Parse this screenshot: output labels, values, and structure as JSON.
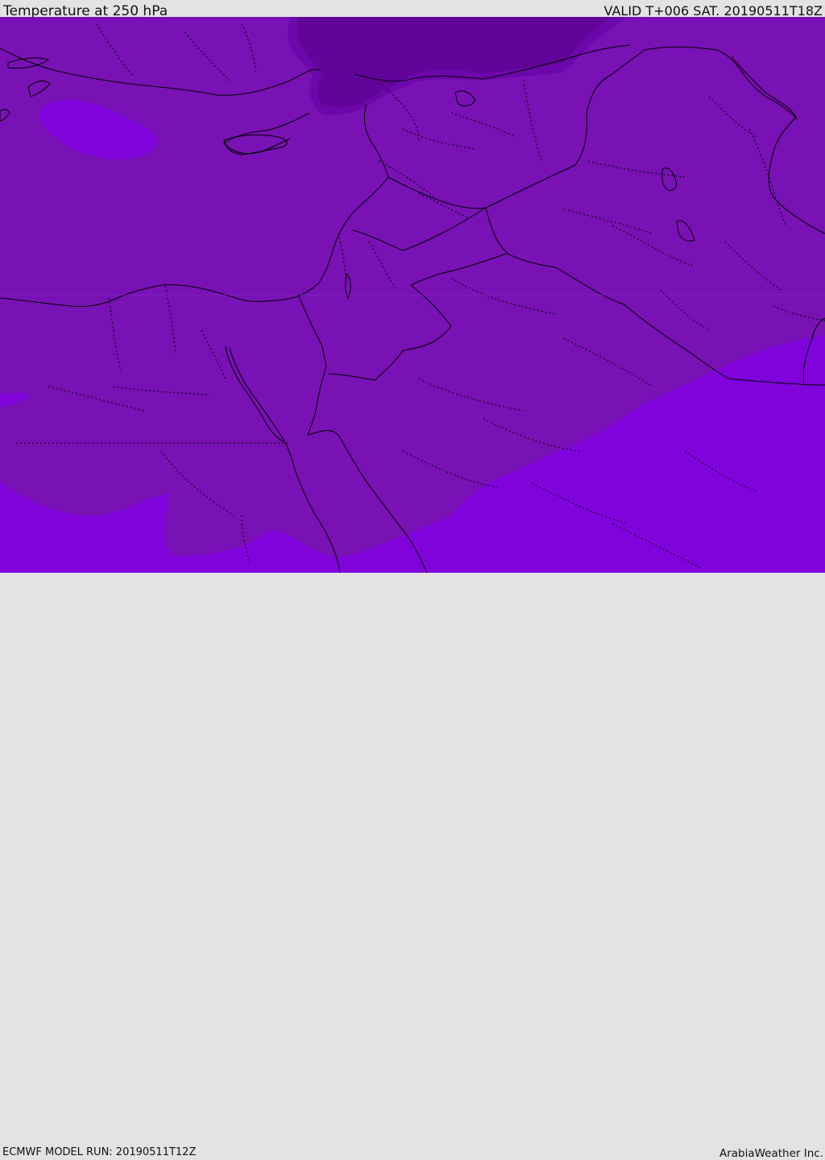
{
  "header": {
    "title": "Temperature at 250 hPa",
    "valid": "VALID T+006 SAT. 20190511T18Z"
  },
  "footer": {
    "model_run": "ECMWF MODEL RUN: 20190511T12Z",
    "credit": "ArabiaWeather Inc."
  },
  "map": {
    "colors": {
      "base": "#7812b4",
      "warm_band": "#8003dc",
      "cold_core": "#61049a",
      "cold_core_edge": "#6c07ab",
      "line": "#000000"
    }
  }
}
